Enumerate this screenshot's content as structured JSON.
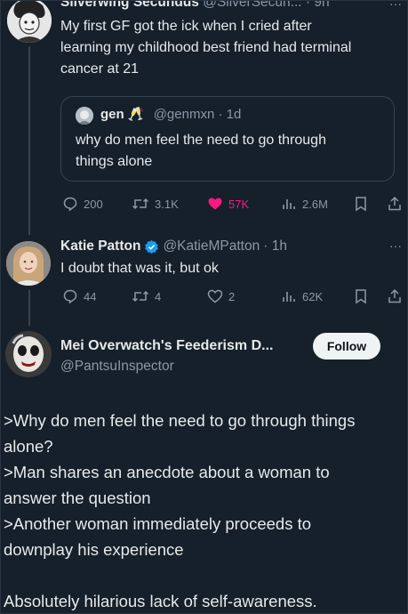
{
  "post1": {
    "name": "Silverwing Secundus",
    "handle": "@SilverSecun...",
    "time": "· 9h",
    "more": "···",
    "text_lines": [
      "My first GF got the ick when I cried after",
      "learning my childhood best friend had terminal",
      "cancer at 21"
    ],
    "quote": {
      "name": "gen",
      "emoji": "🥂",
      "handle": "@genmxn",
      "time": "· 1d",
      "text_lines": [
        "why do men feel the need to go through",
        "things alone"
      ]
    },
    "actions": {
      "replies": "200",
      "reposts": "3.1K",
      "likes": "57K",
      "views": "2.6M"
    },
    "like_color": "#f91880"
  },
  "post2": {
    "name": "Katie Patton",
    "handle": "@KatieMPatton",
    "time": "· 1h",
    "more": "···",
    "text": "I doubt that was it, but ok",
    "actions": {
      "replies": "44",
      "reposts": "4",
      "likes": "2",
      "views": "62K"
    },
    "verified_color": "#1d9bf0"
  },
  "post3": {
    "name": "Mei Overwatch's Feederism D...",
    "handle": "@PantsuInspector",
    "follow_label": "Follow",
    "body_lines": [
      ">Why do men feel the need to go through things",
      "alone?",
      ">Man shares an anecdote about a woman to",
      "answer the question",
      ">Another woman immediately proceeds to",
      "downplay his experience",
      "",
      "Absolutely hilarious lack of self-awareness."
    ]
  }
}
